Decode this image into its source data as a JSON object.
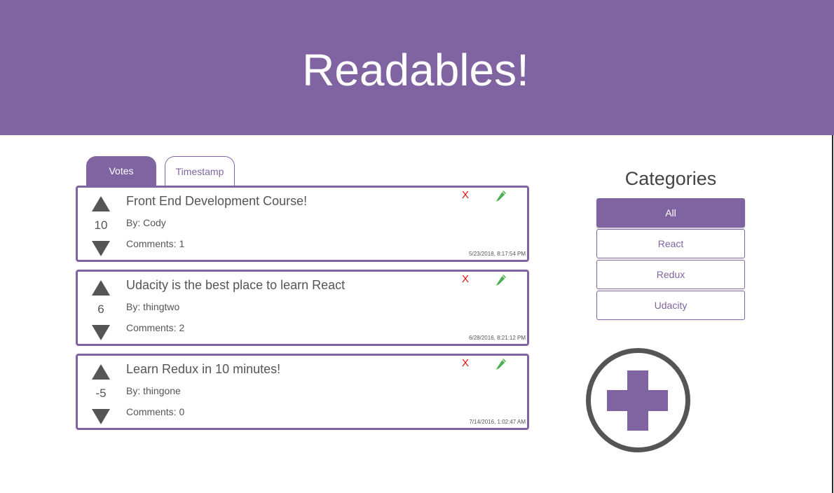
{
  "header": {
    "title": "Readables!"
  },
  "sort_tabs": [
    {
      "label": "Votes",
      "active": true
    },
    {
      "label": "Timestamp",
      "active": false
    }
  ],
  "posts": [
    {
      "title": "Front End Development Course!",
      "author": "By: Cody",
      "comments": "Comments: 1",
      "votes": "10",
      "timestamp": "5/23/2018, 8:17:54 PM",
      "delete_label": "X"
    },
    {
      "title": "Udacity is the best place to learn React",
      "author": "By: thingtwo",
      "comments": "Comments: 2",
      "votes": "6",
      "timestamp": "6/28/2016, 8:21:12 PM",
      "delete_label": "X"
    },
    {
      "title": "Learn Redux in 10 minutes!",
      "author": "By: thingone",
      "comments": "Comments: 0",
      "votes": "-5",
      "timestamp": "7/14/2016, 1:02:47 AM",
      "delete_label": "X"
    }
  ],
  "categories": {
    "title": "Categories",
    "items": [
      {
        "label": "All",
        "active": true
      },
      {
        "label": "React",
        "active": false
      },
      {
        "label": "Redux",
        "active": false
      },
      {
        "label": "Udacity",
        "active": false
      }
    ]
  },
  "colors": {
    "brand": "#8064a2",
    "delete": "#e01010",
    "edit": "#4caf50",
    "arrow": "#555555"
  },
  "icons": {
    "upvote": "triangle-up-icon",
    "downvote": "triangle-down-icon",
    "delete": "x-icon",
    "edit": "pencil-icon",
    "add": "plus-circle-icon"
  }
}
